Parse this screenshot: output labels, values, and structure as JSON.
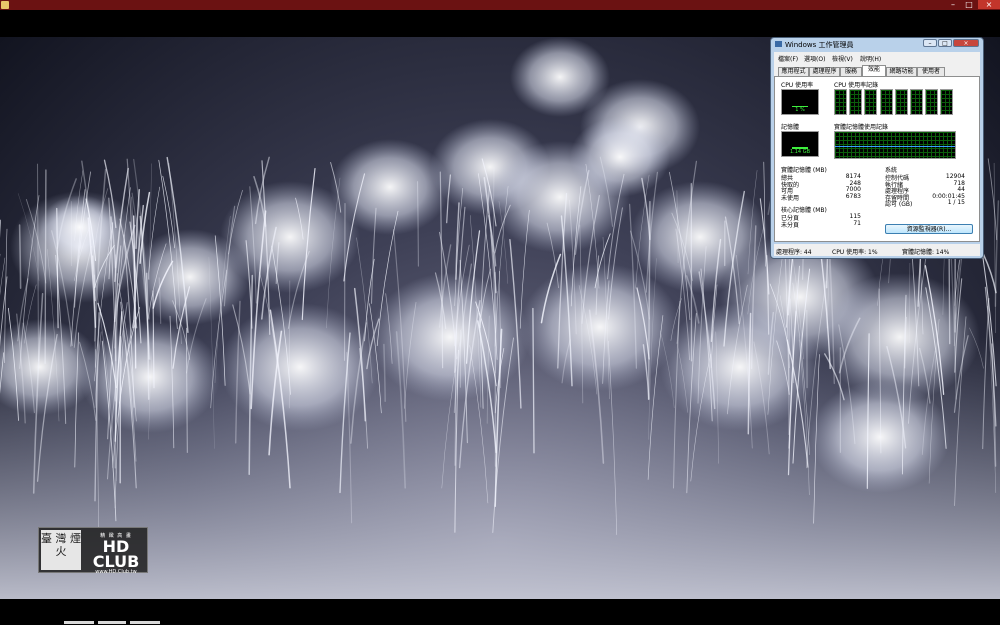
{
  "player": {
    "titlebar_color": "#6b1212",
    "controls": {
      "minimize": "–",
      "maximize": "□",
      "close": "×"
    }
  },
  "watermark": {
    "seal_text": "臺 灣 煙 火",
    "caption": "精 緻 高 畫",
    "logo_text": "HD CLUB",
    "url": "www.HD.Club.tw"
  },
  "taskmgr": {
    "title": "Windows 工作管理員",
    "controls": {
      "minimize": "–",
      "maximize": "□",
      "close": "×"
    },
    "menu": [
      "檔案(F)",
      "選項(O)",
      "檢視(V)",
      "說明(H)"
    ],
    "tabs": [
      "應用程式",
      "處理程序",
      "服務",
      "效能",
      "網路功能",
      "使用者"
    ],
    "active_tab": "效能",
    "cpu_usage_label": "CPU 使用率",
    "cpu_usage_value": "1 %",
    "cpu_usage_percent": 1,
    "cpu_history_label": "CPU 使用率記錄",
    "cpu_core_count": 8,
    "memory_label": "記憶體",
    "memory_value": "1.14 GB",
    "memory_percent": 14,
    "memory_history_label": "實體記憶體使用記錄",
    "physical_memory": {
      "title": "實體記憶體 (MB)",
      "rows": [
        {
          "k": "總共",
          "v": "8174"
        },
        {
          "k": "快取的",
          "v": "248"
        },
        {
          "k": "可用",
          "v": "7000"
        },
        {
          "k": "未使用",
          "v": "6783"
        }
      ]
    },
    "kernel_memory": {
      "title": "核心記憶體 (MB)",
      "rows": [
        {
          "k": "已分頁",
          "v": "115"
        },
        {
          "k": "未分頁",
          "v": "71"
        }
      ]
    },
    "system": {
      "title": "系統",
      "rows": [
        {
          "k": "控制代碼",
          "v": "12904"
        },
        {
          "k": "執行緒",
          "v": "718"
        },
        {
          "k": "處理程序",
          "v": "44"
        },
        {
          "k": "存留時間",
          "v": "0:00:01:45"
        },
        {
          "k": "認可 (GB)",
          "v": "1 / 15"
        }
      ]
    },
    "resource_monitor_button": "資源監視器(R)...",
    "status": {
      "processes": "處理程序: 44",
      "cpu": "CPU 使用率: 1%",
      "memory": "實體記憶體: 14%"
    }
  }
}
